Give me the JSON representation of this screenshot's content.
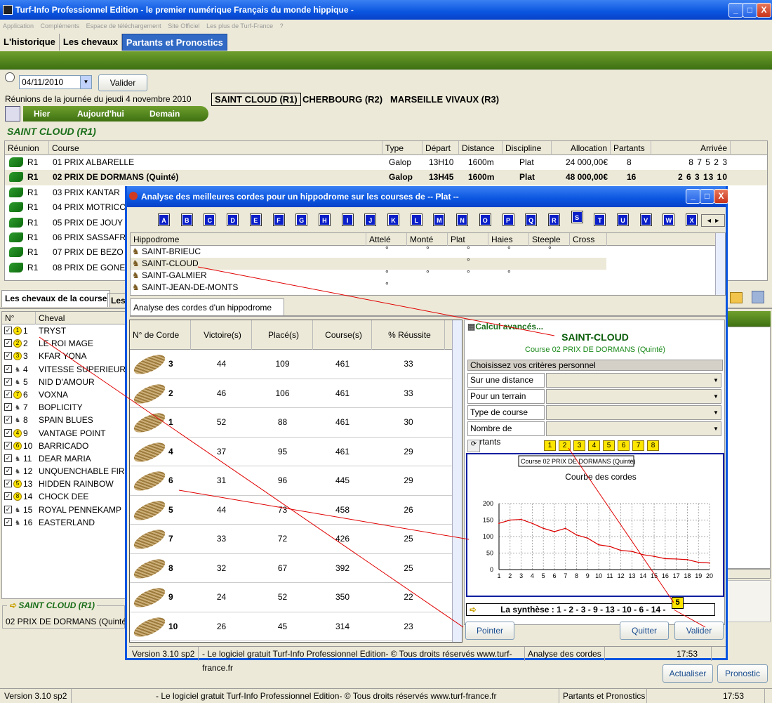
{
  "app": {
    "title": "Turf-Info Professionnel Edition - le premier numérique Français du monde hippique -",
    "min": "_",
    "max": "□",
    "close": "X"
  },
  "menu": [
    "Application",
    "Compléments",
    "Espace de téléchargement",
    "Site Officiel",
    "Les plus de Turf-France",
    "?"
  ],
  "main_tabs": [
    "L'historique",
    "Les chevaux",
    "Partants et Pronostics"
  ],
  "date": {
    "value": "04/11/2010",
    "validate": "Valider"
  },
  "reunions": {
    "label": "Réunions de la journée du jeudi 4 novembre 2010",
    "items": [
      "SAINT CLOUD (R1)",
      "CHERBOURG (R2)",
      "MARSEILLE VIVAUX (R3)"
    ]
  },
  "day_nav": [
    "Hier",
    "Aujourd'hui",
    "Demain"
  ],
  "section_title": "SAINT CLOUD (R1)",
  "courses": {
    "headers": [
      "Réunion",
      "Course",
      "Type",
      "Départ",
      "Distance",
      "Discipline",
      "Allocation",
      "Partants",
      "Arrivée"
    ],
    "rows": [
      {
        "r": "R1",
        "course": "01 PRIX ALBARELLE",
        "type": "Galop",
        "depart": "13H10",
        "distance": "1600m",
        "discipline": "Plat",
        "allocation": "24 000,00€",
        "partants": "8",
        "arrivee": "8 7 5 2 3"
      },
      {
        "r": "R1",
        "course": "02 PRIX DE DORMANS (Quinté)",
        "type": "Galop",
        "depart": "13H45",
        "distance": "1600m",
        "discipline": "Plat",
        "allocation": "48 000,00€",
        "partants": "16",
        "arrivee": "2 6 3 13 10"
      },
      {
        "r": "R1",
        "course": "03 PRIX KANTAR"
      },
      {
        "r": "R1",
        "course": "04 PRIX MOTRICO"
      },
      {
        "r": "R1",
        "course": "05 PRIX DE JOUY"
      },
      {
        "r": "R1",
        "course": "06 PRIX SASSAFR"
      },
      {
        "r": "R1",
        "course": "07 PRIX DE BEZO"
      },
      {
        "r": "R1",
        "course": "08 PRIX DE GONE"
      }
    ]
  },
  "lower_tabs": [
    "Les chevaux de la course",
    "Les"
  ],
  "horses": {
    "headers": [
      "N°",
      "Cheval"
    ],
    "rows": [
      {
        "n": "1",
        "name": "TRYST",
        "badge": "1"
      },
      {
        "n": "2",
        "name": "LE ROI MAGE",
        "badge": "2"
      },
      {
        "n": "3",
        "name": "KFAR YONA",
        "badge": "3"
      },
      {
        "n": "4",
        "name": "VITESSE SUPERIEUR",
        "badge": ""
      },
      {
        "n": "5",
        "name": "NID D'AMOUR",
        "badge": ""
      },
      {
        "n": "6",
        "name": "VOXNA",
        "badge": "7"
      },
      {
        "n": "7",
        "name": "BOPLICITY",
        "badge": ""
      },
      {
        "n": "8",
        "name": "SPAIN BLUES",
        "badge": ""
      },
      {
        "n": "9",
        "name": "VANTAGE POINT",
        "badge": "4"
      },
      {
        "n": "10",
        "name": "BARRICADO",
        "badge": "6"
      },
      {
        "n": "11",
        "name": "DEAR MARIA",
        "badge": ""
      },
      {
        "n": "12",
        "name": "UNQUENCHABLE FIR",
        "badge": ""
      },
      {
        "n": "13",
        "name": "HIDDEN RAINBOW",
        "badge": "5"
      },
      {
        "n": "14",
        "name": "CHOCK DEE",
        "badge": "8"
      },
      {
        "n": "15",
        "name": "ROYAL PENNEKAMP",
        "badge": ""
      },
      {
        "n": "16",
        "name": "EASTERLAND",
        "badge": ""
      }
    ]
  },
  "footer_group": {
    "title": "SAINT CLOUD (R1)",
    "text": "02 PRIX DE DORMANS (Quinté) F"
  },
  "main_buttons": {
    "refresh": "Actualiser",
    "prono": "Pronostic"
  },
  "statusbar": [
    "Version 3.10 sp2",
    "- Le logiciel gratuit Turf-Info Professionnel Edition- © Tous droits réservés www.turf-france.fr",
    "Partants et Pronostics",
    "17:53"
  ],
  "dialog": {
    "title": "Analyse des meilleures cordes pour un hippodrome sur les courses de -- Plat --",
    "letters": [
      "A",
      "B",
      "C",
      "D",
      "E",
      "F",
      "G",
      "H",
      "I",
      "J",
      "K",
      "L",
      "M",
      "N",
      "O",
      "P",
      "Q",
      "R",
      "S",
      "T",
      "U",
      "V",
      "W",
      "X"
    ],
    "hippo_headers": [
      "Hippodrome",
      "Attelé",
      "Monté",
      "Plat",
      "Haies",
      "Steeple",
      "Cross"
    ],
    "hippo_rows": [
      {
        "name": "SAINT-BRIEUC",
        "marks": [
          1,
          1,
          1,
          1,
          1,
          0
        ]
      },
      {
        "name": "SAINT-CLOUD",
        "marks": [
          0,
          0,
          1,
          0,
          0,
          0
        ]
      },
      {
        "name": "SAINT-GALMIER",
        "marks": [
          1,
          1,
          1,
          1,
          0,
          0
        ]
      },
      {
        "name": "SAINT-JEAN-DE-MONTS",
        "marks": [
          1,
          0,
          0,
          0,
          0,
          0
        ]
      }
    ],
    "mark": "°",
    "sub_tab": "Analyse des cordes d'un hippodrome",
    "corde_headers": [
      "N° de Corde",
      "Victoire(s)",
      "Placé(s)",
      "Course(s)",
      "% Réussite"
    ],
    "cordes": [
      {
        "c": "3",
        "v": "44",
        "p": "109",
        "co": "461",
        "pct": "33"
      },
      {
        "c": "2",
        "v": "46",
        "p": "106",
        "co": "461",
        "pct": "33"
      },
      {
        "c": "1",
        "v": "52",
        "p": "88",
        "co": "461",
        "pct": "30"
      },
      {
        "c": "4",
        "v": "37",
        "p": "95",
        "co": "461",
        "pct": "29"
      },
      {
        "c": "6",
        "v": "31",
        "p": "96",
        "co": "445",
        "pct": "29"
      },
      {
        "c": "5",
        "v": "44",
        "p": "73",
        "co": "458",
        "pct": "26"
      },
      {
        "c": "7",
        "v": "33",
        "p": "72",
        "co": "426",
        "pct": "25"
      },
      {
        "c": "8",
        "v": "32",
        "p": "67",
        "co": "392",
        "pct": "25"
      },
      {
        "c": "9",
        "v": "24",
        "p": "52",
        "co": "350",
        "pct": "22"
      },
      {
        "c": "10",
        "v": "26",
        "p": "45",
        "co": "314",
        "pct": "23"
      }
    ],
    "calc": "Calcul avancés...",
    "hippo_title": "SAINT-CLOUD",
    "course_title": "Course 02 PRIX DE DORMANS (Quinté)",
    "criteria_title": "Choisissez vos critères personnel",
    "criteria": [
      "Sur une distance",
      "Pour un terrain",
      "Type de course",
      "Nombre de partants"
    ],
    "ybuttons": [
      "1",
      "2",
      "3",
      "4",
      "5",
      "6",
      "7",
      "8"
    ],
    "chart_label": "Course 02 PRIX DE DORMANS (Quinté)",
    "synth": "La synthèse : 1 - 2 - 3 - 9 - 13 - 10 - 6 - 14 -",
    "pointer_badge": "5",
    "buttons": {
      "pointer": "Pointer",
      "quit": "Quitter",
      "validate": "Valider"
    },
    "status": [
      "Version 3.10 sp2",
      "- Le logiciel gratuit Turf-Info Professionnel Edition- © Tous droits réservés www.turf-france.fr",
      "Analyse des cordes",
      "17:53"
    ]
  },
  "chart_data": {
    "type": "line",
    "title": "Courbe des cordes",
    "x": [
      1,
      2,
      3,
      4,
      5,
      6,
      7,
      8,
      9,
      10,
      11,
      12,
      13,
      14,
      15,
      16,
      17,
      18,
      19,
      20
    ],
    "series": [
      {
        "values": [
          140,
          150,
          152,
          140,
          125,
          115,
          125,
          105,
          95,
          75,
          70,
          58,
          55,
          45,
          40,
          33,
          32,
          30,
          22,
          20
        ]
      }
    ],
    "ylim": [
      0,
      200
    ],
    "yticks": [
      0,
      50,
      100,
      150,
      200
    ],
    "grid": true,
    "color": "#dd0000"
  }
}
